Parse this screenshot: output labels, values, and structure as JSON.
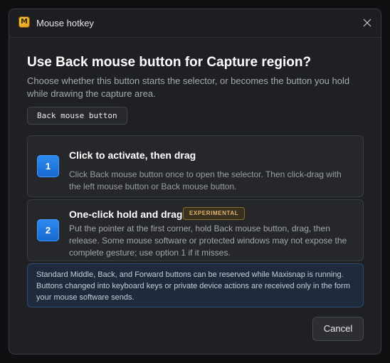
{
  "window": {
    "title": "Mouse hotkey",
    "app_icon": "maxisnap-app-icon",
    "app_icon_glyph": "M",
    "close_icon": "close-icon"
  },
  "dialog": {
    "heading": "Use Back mouse button for Capture region?",
    "subtitle": "Choose whether this button starts the selector, or becomes the button you hold while drawing the capture area.",
    "button_chip": "Back mouse button"
  },
  "options": [
    {
      "number": "1",
      "title": "Click to activate, then drag",
      "description": "Click Back mouse button once to open the selector. Then click-drag with the left mouse button or Back mouse button."
    },
    {
      "number": "2",
      "title": "One-click hold and drag",
      "tag": "EXPERIMENTAL",
      "description": "Put the pointer at the first corner, hold Back mouse button, drag, then release. Some mouse software or protected windows may not expose the complete gesture; use option 1 if it misses."
    }
  ],
  "info": {
    "text": "Standard Middle, Back, and Forward buttons can be reserved while Maxisnap is running. Buttons changed into keyboard keys or private device actions are received only in the form your mouse software sends."
  },
  "footer": {
    "cancel_label": "Cancel"
  },
  "colors": {
    "dialog_bg": "#1e2024",
    "accent_blue": "#2d8cf0",
    "tag_amber": "#e0b56a",
    "info_bg": "#1f2b3d"
  }
}
